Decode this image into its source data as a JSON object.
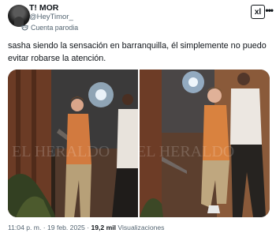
{
  "author": {
    "display_name": "T! MOR",
    "handle": "@HeyTimor_",
    "label": "Cuenta parodia"
  },
  "actions": {
    "grok_icon": "xl",
    "more_icon": "•••"
  },
  "tweet": {
    "text": "sasha siendo la sensación en barranquilla, él simplemente no puedo evitar robarse la atención."
  },
  "media": {
    "watermark": "EL HERALDO"
  },
  "meta": {
    "time": "11:04 p. m.",
    "sep1": "·",
    "date": "19 feb. 2025",
    "sep2": "·",
    "views_count": "19,2 mil",
    "views_label": "Visualizaciones"
  }
}
